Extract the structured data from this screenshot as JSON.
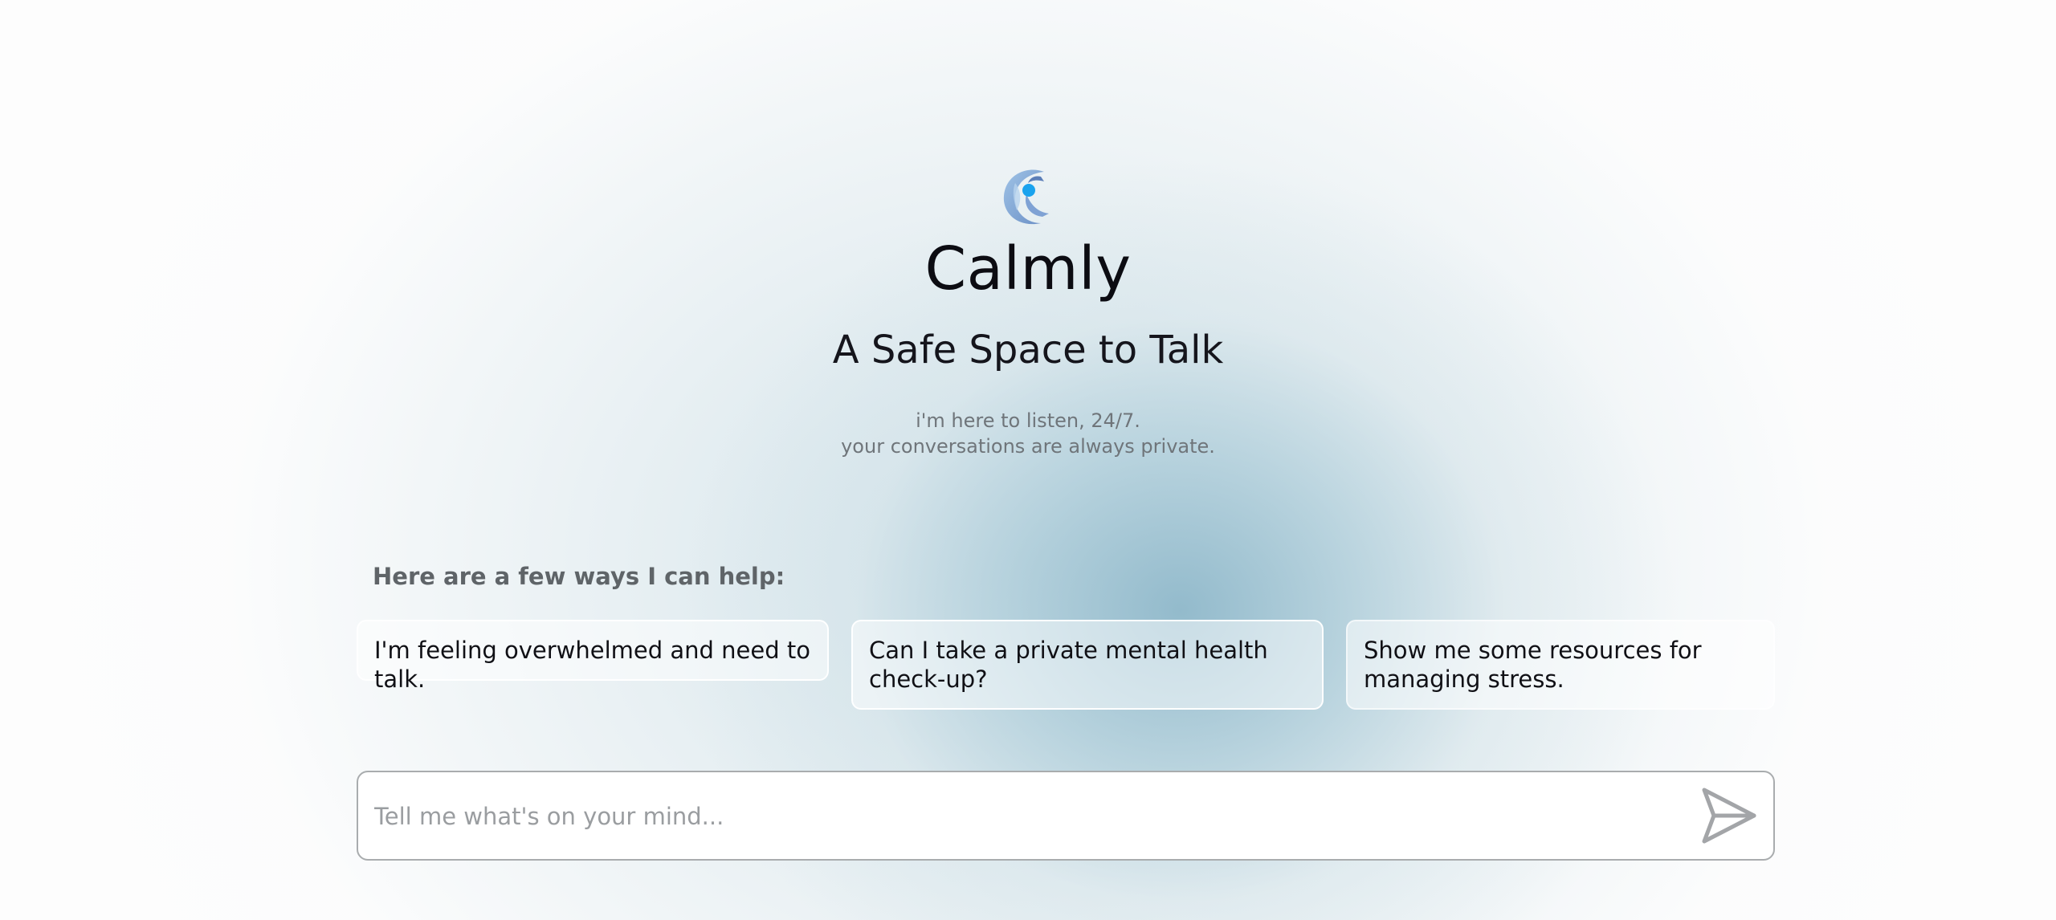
{
  "brand": {
    "name": "Calmly",
    "tagline": "A Safe Space to Talk",
    "subtitle_line1": "i'm here to listen, 24/7.",
    "subtitle_line2": "your conversations are always private.",
    "logo_icon": "calmly-logo-icon",
    "accent_color": "#1aa3ee"
  },
  "suggestions": {
    "heading": "Here are a few ways I can help:",
    "items": [
      {
        "label": "I'm feeling overwhelmed and need to talk."
      },
      {
        "label": "Can I take a private mental health check-up?"
      },
      {
        "label": "Show me some resources for managing stress."
      }
    ]
  },
  "composer": {
    "placeholder": "Tell me what's on your mind...",
    "value": "",
    "send_icon": "send-icon"
  }
}
